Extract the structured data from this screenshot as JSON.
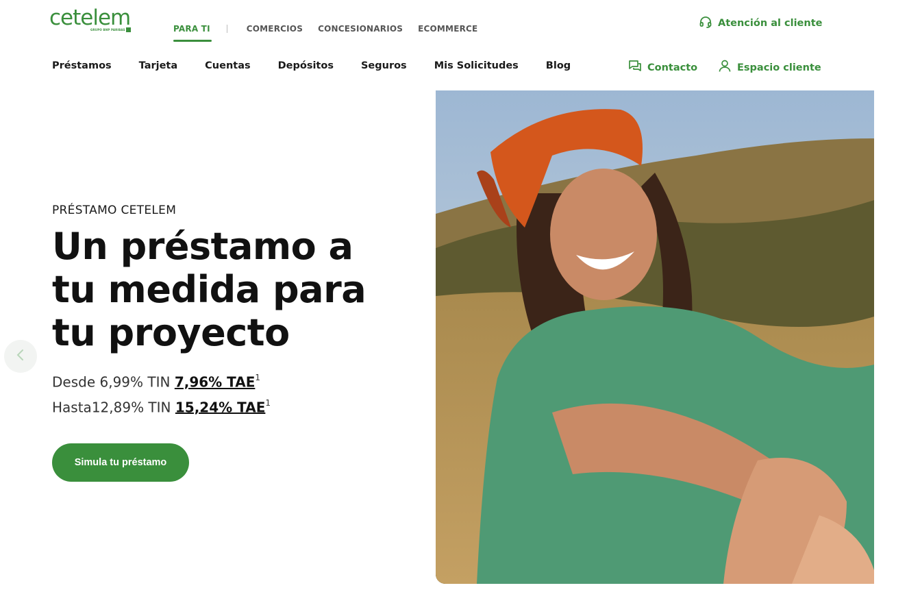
{
  "brand": {
    "name": "cetelem",
    "tagline": "GRUPO BNP PARIBAS"
  },
  "segments": [
    {
      "label": "PARA TI",
      "active": true
    },
    {
      "label": "COMERCIOS",
      "active": false
    },
    {
      "label": "CONCESIONARIOS",
      "active": false
    },
    {
      "label": "ECOMMERCE",
      "active": false
    }
  ],
  "support": {
    "label": "Atención al cliente",
    "icon": "headset-icon"
  },
  "nav": [
    "Préstamos",
    "Tarjeta",
    "Cuentas",
    "Depósitos",
    "Seguros",
    "Mis Solicitudes",
    "Blog"
  ],
  "utility": {
    "contact": {
      "label": "Contacto",
      "icon": "chat-icon"
    },
    "client": {
      "label": "Espacio cliente",
      "icon": "user-icon"
    }
  },
  "hero": {
    "eyebrow": "PRÉSTAMO CETELEM",
    "headline": [
      "Un préstamo a",
      "tu medida para",
      "tu proyecto"
    ],
    "rate1": {
      "prefix": "Desde 6,99% TIN ",
      "tae": "7,96% TAE",
      "sup": "1"
    },
    "rate2": {
      "prefix": "Hasta12,89% TIN ",
      "tae": "15,24% TAE",
      "sup": "1"
    },
    "cta": "Simula tu préstamo"
  },
  "colors": {
    "brand_green": "#3a8f3c",
    "text": "#1a1a1a"
  }
}
